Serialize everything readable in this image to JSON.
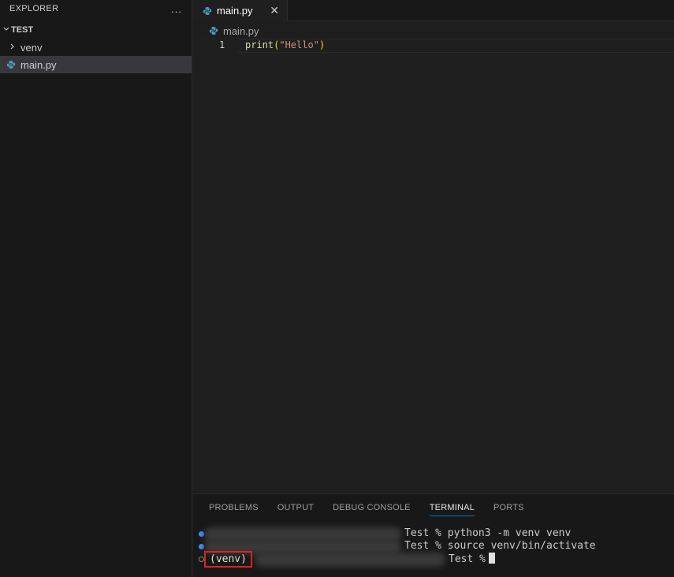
{
  "sidebar": {
    "title": "EXPLORER",
    "more_icon": "...",
    "folder": "TEST",
    "items": [
      {
        "label": "venv",
        "icon": "chevron-right-icon"
      },
      {
        "label": "main.py",
        "icon": "python-file-icon"
      }
    ]
  },
  "editor": {
    "tab_label": "main.py",
    "tab_close": "✕",
    "breadcrumb": "main.py",
    "line_number": "1",
    "code": {
      "fn": "print",
      "open": "(",
      "str": "\"Hello\"",
      "close": ")"
    }
  },
  "panel": {
    "tabs": [
      "PROBLEMS",
      "OUTPUT",
      "DEBUG CONSOLE",
      "TERMINAL",
      "PORTS"
    ],
    "active_tab": "TERMINAL",
    "terminal": {
      "line1": "Test % python3 -m venv venv",
      "line2": "Test % source venv/bin/activate",
      "line3_prefix": "(venv)",
      "line3": "Test %"
    }
  },
  "colors": {
    "accent": "#0078d4",
    "highlight_box": "#e02020",
    "python_blue": "#519aba"
  }
}
